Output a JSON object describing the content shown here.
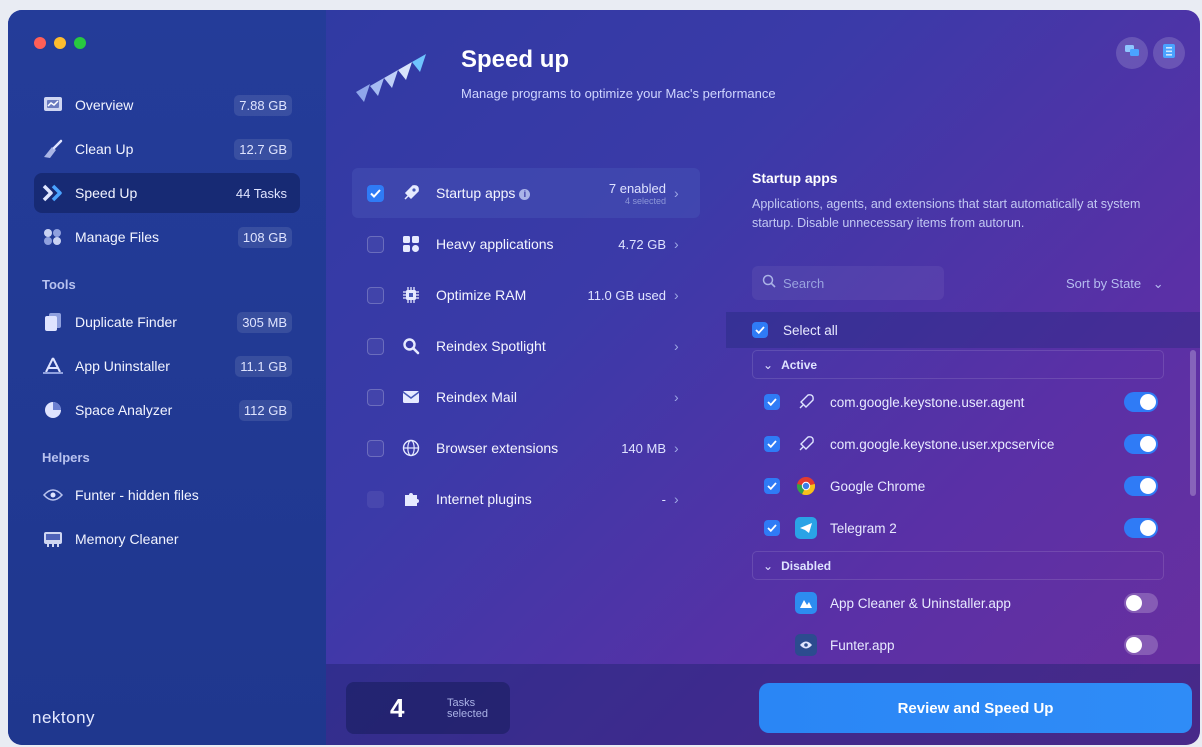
{
  "window": {
    "traffic_colors": [
      "#ff5f57",
      "#febc2e",
      "#28c840"
    ]
  },
  "sidebar": {
    "items": [
      {
        "label": "Overview",
        "badge": "7.88 GB",
        "icon": "overview-icon"
      },
      {
        "label": "Clean Up",
        "badge": "12.7 GB",
        "icon": "broom-icon"
      },
      {
        "label": "Speed Up",
        "badge": "44 Tasks",
        "icon": "speed-icon",
        "active": true
      },
      {
        "label": "Manage Files",
        "badge": "108 GB",
        "icon": "files-icon"
      }
    ],
    "tools_title": "Tools",
    "tools": [
      {
        "label": "Duplicate Finder",
        "badge": "305 MB",
        "icon": "duplicate-icon"
      },
      {
        "label": "App Uninstaller",
        "badge": "11.1 GB",
        "icon": "uninstaller-icon"
      },
      {
        "label": "Space Analyzer",
        "badge": "112 GB",
        "icon": "pie-chart-icon"
      }
    ],
    "helpers_title": "Helpers",
    "helpers": [
      {
        "label": "Funter - hidden files",
        "icon": "eye-icon"
      },
      {
        "label": "Memory Cleaner",
        "icon": "memory-icon"
      }
    ],
    "brand": "nektony"
  },
  "header": {
    "title": "Speed up",
    "subtitle": "Manage programs to optimize your Mac's performance"
  },
  "tasks": [
    {
      "label": "Startup apps",
      "value": "7 enabled",
      "sub": "4 selected",
      "checked": true,
      "active": true,
      "icon": "rocket-icon"
    },
    {
      "label": "Heavy applications",
      "value": "4.72 GB",
      "checked": false,
      "icon": "apps-grid-icon"
    },
    {
      "label": "Optimize RAM",
      "value": "11.0 GB used",
      "checked": false,
      "icon": "chip-icon"
    },
    {
      "label": "Reindex Spotlight",
      "value": "",
      "checked": false,
      "icon": "search-icon"
    },
    {
      "label": "Reindex Mail",
      "value": "",
      "checked": false,
      "icon": "mail-icon"
    },
    {
      "label": "Browser extensions",
      "value": "140 MB",
      "checked": false,
      "icon": "globe-icon"
    },
    {
      "label": "Internet plugins",
      "value": "-",
      "checked": false,
      "icon": "puzzle-icon"
    }
  ],
  "detail": {
    "title": "Startup apps",
    "description": "Applications, agents, and extensions that start automatically at system startup. Disable unnecessary items from autorun.",
    "search_placeholder": "Search",
    "sort_label": "Sort by State",
    "select_all": "Select all",
    "active_group": "Active",
    "disabled_group": "Disabled",
    "active_items": [
      {
        "name": "com.google.keystone.user.agent",
        "icon": "rocket-icon",
        "enabled": true
      },
      {
        "name": "com.google.keystone.user.xpcservice",
        "icon": "rocket-icon",
        "enabled": true
      },
      {
        "name": "Google Chrome",
        "icon": "chrome-icon",
        "enabled": true
      },
      {
        "name": "Telegram 2",
        "icon": "telegram-icon",
        "enabled": true
      }
    ],
    "disabled_items": [
      {
        "name": "App Cleaner & Uninstaller.app",
        "icon": "app-cleaner-icon",
        "enabled": false
      },
      {
        "name": "Funter.app",
        "icon": "funter-eye-icon",
        "enabled": false
      }
    ]
  },
  "footer": {
    "count": "4",
    "count_label_line1": "Tasks",
    "count_label_line2": "selected",
    "cta": "Review and Speed Up"
  }
}
